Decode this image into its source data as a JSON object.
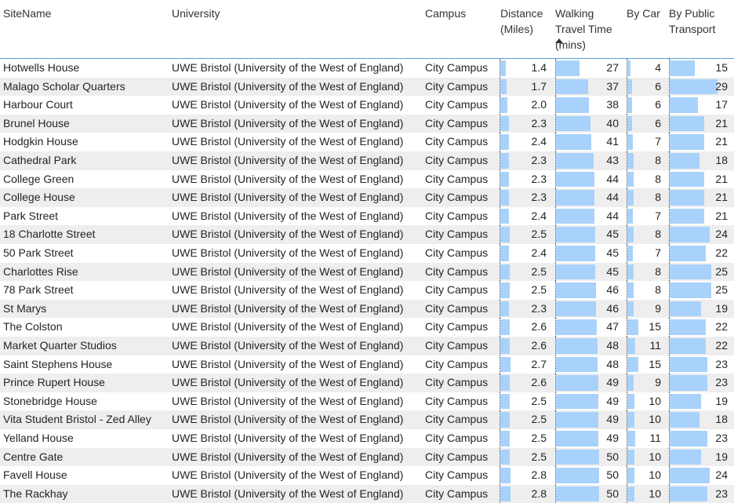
{
  "headers": {
    "site": "SiteName",
    "university": "University",
    "campus": "Campus",
    "distance_l1": "Distance",
    "distance_l2": "(Miles)",
    "walk_l1": "Walking",
    "walk_l2": "Travel Time",
    "walk_l3": "(mins)",
    "car": "By Car",
    "pt_l1": "By Public",
    "pt_l2": "Transport"
  },
  "colors": {
    "bar": "#a8d2fb",
    "header_rule": "#5b9bd5",
    "alt_row": "#eeeeee"
  },
  "rows": [
    {
      "site": "Hotwells House",
      "university": "UWE Bristol (University of the West of England)",
      "campus": "City Campus",
      "distance": "1.4",
      "walk": "27",
      "car": "4",
      "pt": "15"
    },
    {
      "site": "Malago Scholar Quarters",
      "university": "UWE Bristol (University of the West of England)",
      "campus": "City Campus",
      "distance": "1.7",
      "walk": "37",
      "car": "6",
      "pt": "29"
    },
    {
      "site": "Harbour Court",
      "university": "UWE Bristol (University of the West of England)",
      "campus": "City Campus",
      "distance": "2.0",
      "walk": "38",
      "car": "6",
      "pt": "17"
    },
    {
      "site": "Brunel House",
      "university": "UWE Bristol (University of the West of England)",
      "campus": "City Campus",
      "distance": "2.3",
      "walk": "40",
      "car": "6",
      "pt": "21"
    },
    {
      "site": "Hodgkin House",
      "university": "UWE Bristol (University of the West of England)",
      "campus": "City Campus",
      "distance": "2.4",
      "walk": "41",
      "car": "7",
      "pt": "21"
    },
    {
      "site": "Cathedral Park",
      "university": "UWE Bristol (University of the West of England)",
      "campus": "City Campus",
      "distance": "2.3",
      "walk": "43",
      "car": "8",
      "pt": "18"
    },
    {
      "site": "College Green",
      "university": "UWE Bristol (University of the West of England)",
      "campus": "City Campus",
      "distance": "2.3",
      "walk": "44",
      "car": "8",
      "pt": "21"
    },
    {
      "site": "College House",
      "university": "UWE Bristol (University of the West of England)",
      "campus": "City Campus",
      "distance": "2.3",
      "walk": "44",
      "car": "8",
      "pt": "21"
    },
    {
      "site": "Park Street",
      "university": "UWE Bristol (University of the West of England)",
      "campus": "City Campus",
      "distance": "2.4",
      "walk": "44",
      "car": "7",
      "pt": "21"
    },
    {
      "site": "18 Charlotte Street",
      "university": "UWE Bristol (University of the West of England)",
      "campus": "City Campus",
      "distance": "2.5",
      "walk": "45",
      "car": "8",
      "pt": "24"
    },
    {
      "site": "50 Park Street",
      "university": "UWE Bristol (University of the West of England)",
      "campus": "City Campus",
      "distance": "2.4",
      "walk": "45",
      "car": "7",
      "pt": "22"
    },
    {
      "site": "Charlottes Rise",
      "university": "UWE Bristol (University of the West of England)",
      "campus": "City Campus",
      "distance": "2.5",
      "walk": "45",
      "car": "8",
      "pt": "25"
    },
    {
      "site": "78 Park Street",
      "university": "UWE Bristol (University of the West of England)",
      "campus": "City Campus",
      "distance": "2.5",
      "walk": "46",
      "car": "8",
      "pt": "25"
    },
    {
      "site": "St Marys",
      "university": "UWE Bristol (University of the West of England)",
      "campus": "City Campus",
      "distance": "2.3",
      "walk": "46",
      "car": "9",
      "pt": "19"
    },
    {
      "site": "The Colston",
      "university": "UWE Bristol (University of the West of England)",
      "campus": "City Campus",
      "distance": "2.6",
      "walk": "47",
      "car": "15",
      "pt": "22"
    },
    {
      "site": "Market Quarter Studios",
      "university": "UWE Bristol (University of the West of England)",
      "campus": "City Campus",
      "distance": "2.6",
      "walk": "48",
      "car": "11",
      "pt": "22"
    },
    {
      "site": "Saint Stephens House",
      "university": "UWE Bristol (University of the West of England)",
      "campus": "City Campus",
      "distance": "2.7",
      "walk": "48",
      "car": "15",
      "pt": "23"
    },
    {
      "site": "Prince Rupert House",
      "university": "UWE Bristol (University of the West of England)",
      "campus": "City Campus",
      "distance": "2.6",
      "walk": "49",
      "car": "9",
      "pt": "23"
    },
    {
      "site": "Stonebridge House",
      "university": "UWE Bristol (University of the West of England)",
      "campus": "City Campus",
      "distance": "2.5",
      "walk": "49",
      "car": "10",
      "pt": "19"
    },
    {
      "site": "Vita Student Bristol - Zed Alley",
      "university": "UWE Bristol (University of the West of England)",
      "campus": "City Campus",
      "distance": "2.5",
      "walk": "49",
      "car": "10",
      "pt": "18"
    },
    {
      "site": "Yelland House",
      "university": "UWE Bristol (University of the West of England)",
      "campus": "City Campus",
      "distance": "2.5",
      "walk": "49",
      "car": "11",
      "pt": "23"
    },
    {
      "site": "Centre Gate",
      "university": "UWE Bristol (University of the West of England)",
      "campus": "City Campus",
      "distance": "2.5",
      "walk": "50",
      "car": "10",
      "pt": "19"
    },
    {
      "site": "Favell House",
      "university": "UWE Bristol (University of the West of England)",
      "campus": "City Campus",
      "distance": "2.8",
      "walk": "50",
      "car": "10",
      "pt": "24"
    },
    {
      "site": "The Rackhay",
      "university": "UWE Bristol (University of the West of England)",
      "campus": "City Campus",
      "distance": "2.8",
      "walk": "50",
      "car": "10",
      "pt": "23"
    }
  ]
}
